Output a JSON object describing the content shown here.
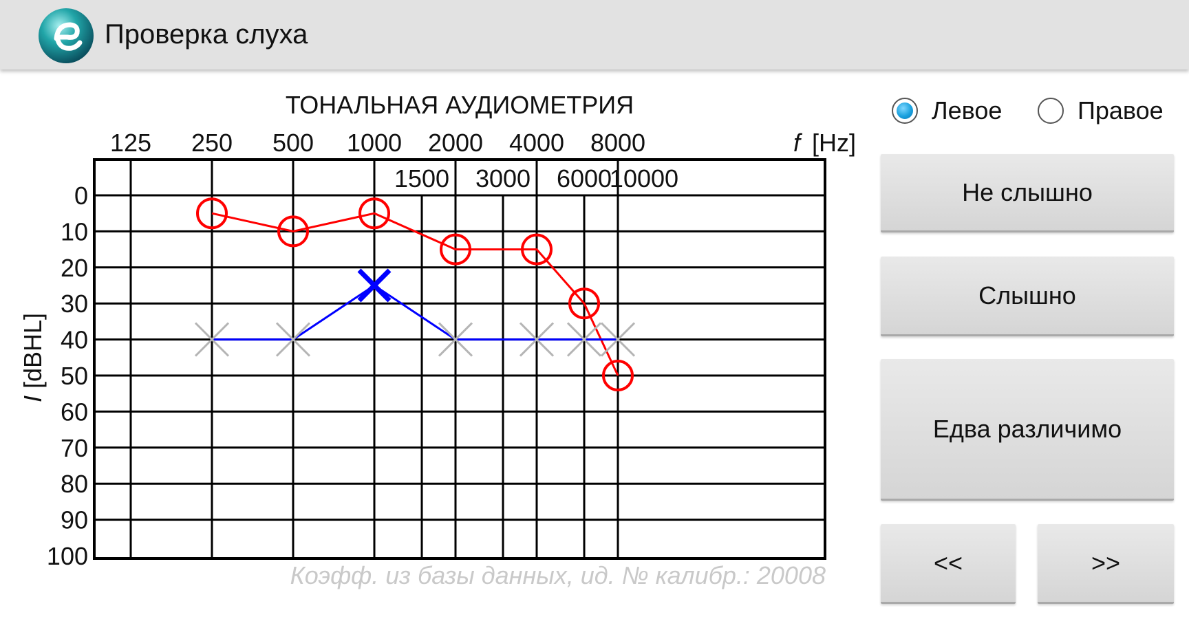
{
  "app": {
    "title": "Проверка слуха",
    "logo_icon": "app-logo-icon"
  },
  "chart_data": {
    "type": "line",
    "title": "ТОНАЛЬНАЯ АУДИОМЕТРИЯ",
    "x_unit": "[Hz]",
    "x_symbol": "f",
    "y_unit": "[dBHL]",
    "y_symbol": "I",
    "x_ticks_top": [
      "125",
      "250",
      "500",
      "1000",
      "2000",
      "4000",
      "8000"
    ],
    "x_ticks_mid": [
      "1500",
      "3000",
      "6000",
      "10000"
    ],
    "x_scale": "log",
    "y_ticks": [
      "0",
      "10",
      "20",
      "30",
      "40",
      "50",
      "60",
      "70",
      "80",
      "90",
      "100"
    ],
    "ylim": [
      0,
      100
    ],
    "y_inverted": true,
    "grid": true,
    "series": [
      {
        "marker": "circle",
        "color": "#ff0000",
        "x": [
          250,
          500,
          1000,
          2000,
          4000,
          6000,
          8000
        ],
        "values": [
          5,
          10,
          5,
          15,
          15,
          30,
          50
        ]
      },
      {
        "marker": "cross",
        "color": "#0000ff",
        "x": [
          250,
          500,
          1000,
          2000,
          4000,
          6000,
          8000
        ],
        "values": [
          40,
          40,
          25,
          40,
          40,
          40,
          40
        ],
        "highlight_index": 2,
        "highlight_color": "#0000ff",
        "marker_color": "#b5b5b5"
      }
    ]
  },
  "calibration_note": "Коэфф. из базы данных, ид. № калибр.: 20008",
  "ear_select": {
    "left_label": "Левое",
    "right_label": "Правое",
    "selected": "left"
  },
  "buttons": {
    "not_heard": "Не слышно",
    "heard": "Слышно",
    "barely": "Едва различимо",
    "prev": "<<",
    "next": ">>"
  },
  "colors": {
    "appbar": "#e2e2e2",
    "button": "#dddddd",
    "radio_accent": "#1aa1de"
  }
}
